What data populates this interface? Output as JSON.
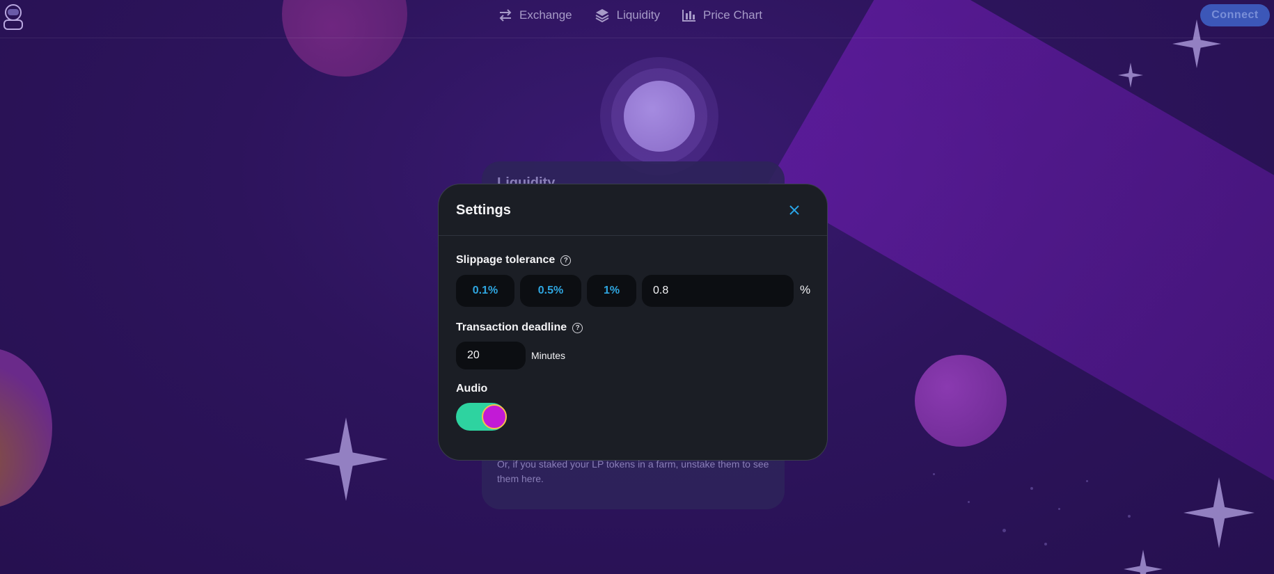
{
  "nav": {
    "items": [
      {
        "label": "Exchange",
        "icon": "swap-icon"
      },
      {
        "label": "Liquidity",
        "icon": "layers-icon"
      },
      {
        "label": "Price Chart",
        "icon": "bar-chart-icon"
      }
    ],
    "connect_label": "Connect"
  },
  "background_card": {
    "title": "Liquidity",
    "text": "Or, if you staked your LP tokens in a farm, unstake them to see them here."
  },
  "settings": {
    "title": "Settings",
    "slippage": {
      "label": "Slippage tolerance",
      "options": [
        "0.1%",
        "0.5%",
        "1%"
      ],
      "custom_value": "0.8",
      "unit": "%"
    },
    "deadline": {
      "label": "Transaction deadline",
      "value": "20",
      "unit": "Minutes"
    },
    "audio": {
      "label": "Audio",
      "enabled": true
    }
  },
  "colors": {
    "accent": "#2fa6e0",
    "toggle_on": "#2ed3a0",
    "knob": "#c21ad6",
    "modal_bg": "#1b1e25"
  }
}
